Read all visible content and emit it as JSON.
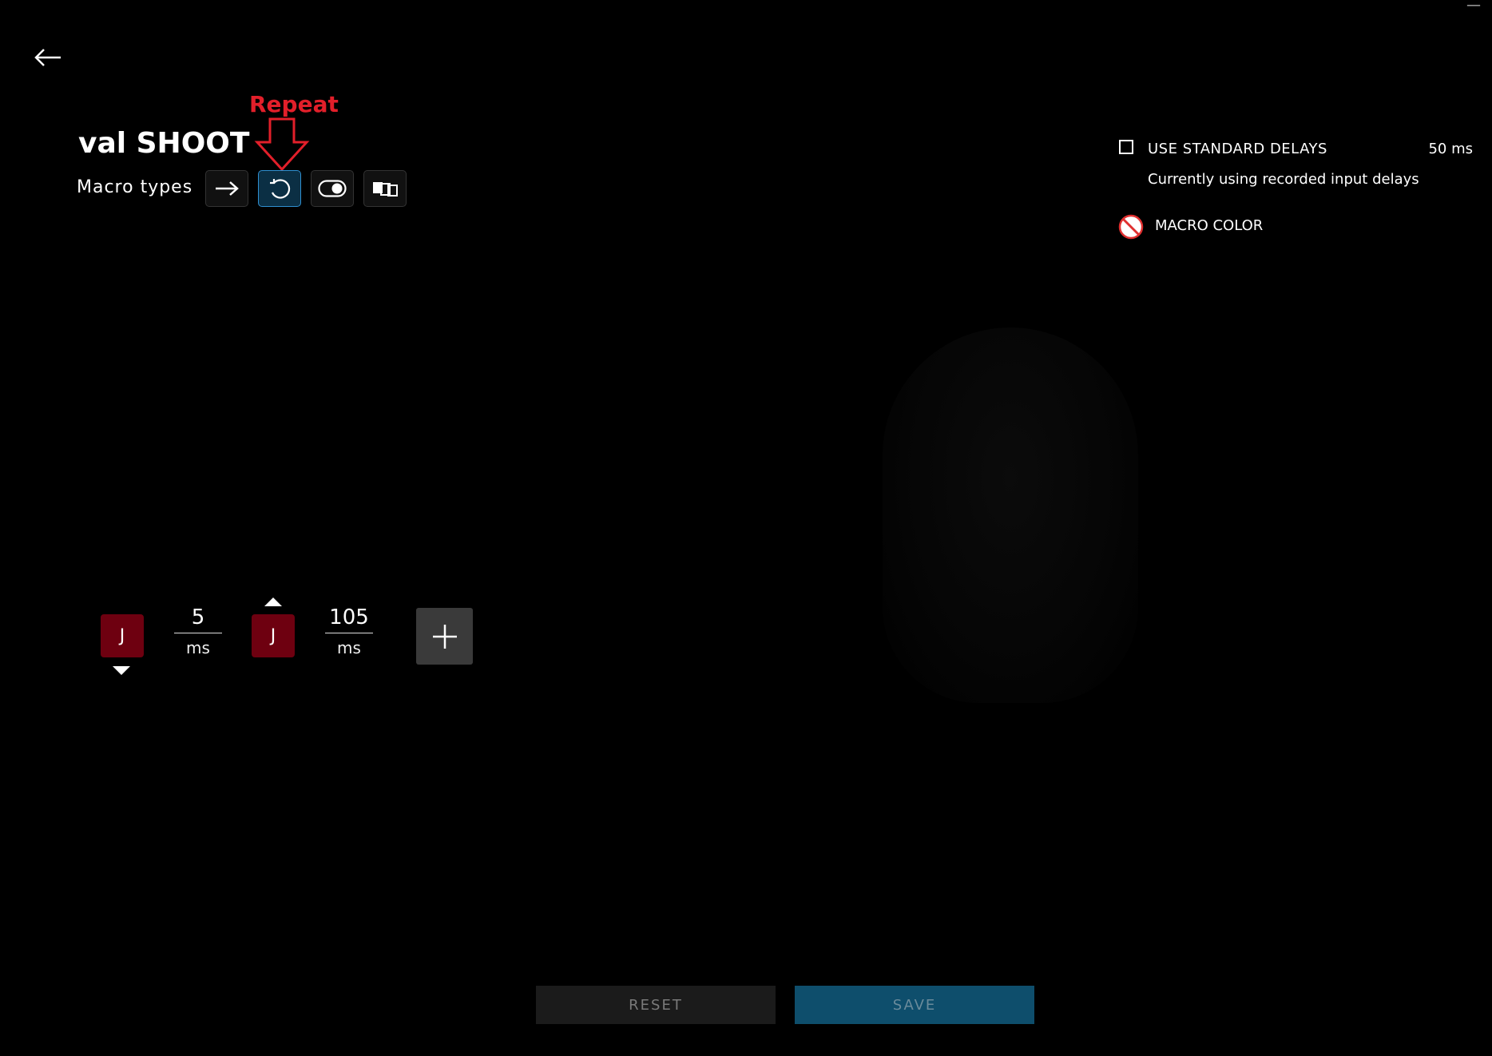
{
  "window": {
    "minimize_label": "—"
  },
  "annotation": {
    "label": "Repeat",
    "color": "#e21f2a"
  },
  "macro": {
    "title": "val SHOOT",
    "types_label": "Macro types",
    "types": [
      {
        "name": "no-repeat",
        "icon": "arrow-right-icon"
      },
      {
        "name": "repeat",
        "icon": "repeat-icon",
        "active": true
      },
      {
        "name": "toggle",
        "icon": "toggle-icon"
      },
      {
        "name": "sequence",
        "icon": "sequence-icon"
      }
    ]
  },
  "sequence": {
    "steps": [
      {
        "kind": "key",
        "label": "J"
      },
      {
        "kind": "delay",
        "value": "5",
        "unit": "ms"
      },
      {
        "kind": "key",
        "label": "J"
      },
      {
        "kind": "delay",
        "value": "105",
        "unit": "ms"
      }
    ],
    "add_label": "+"
  },
  "settings": {
    "use_standard_delays": "USE STANDARD DELAYS",
    "standard_delay": "50 ms",
    "standard_delays_checked": false,
    "delay_status": "Currently using recorded input delays",
    "macro_color_label": "MACRO COLOR"
  },
  "footer": {
    "reset_label": "RESET",
    "save_label": "SAVE"
  },
  "colors": {
    "key_bg": "#6e0010",
    "active_accent": "#2f8fd0",
    "save_bg": "#0e4e6c"
  }
}
